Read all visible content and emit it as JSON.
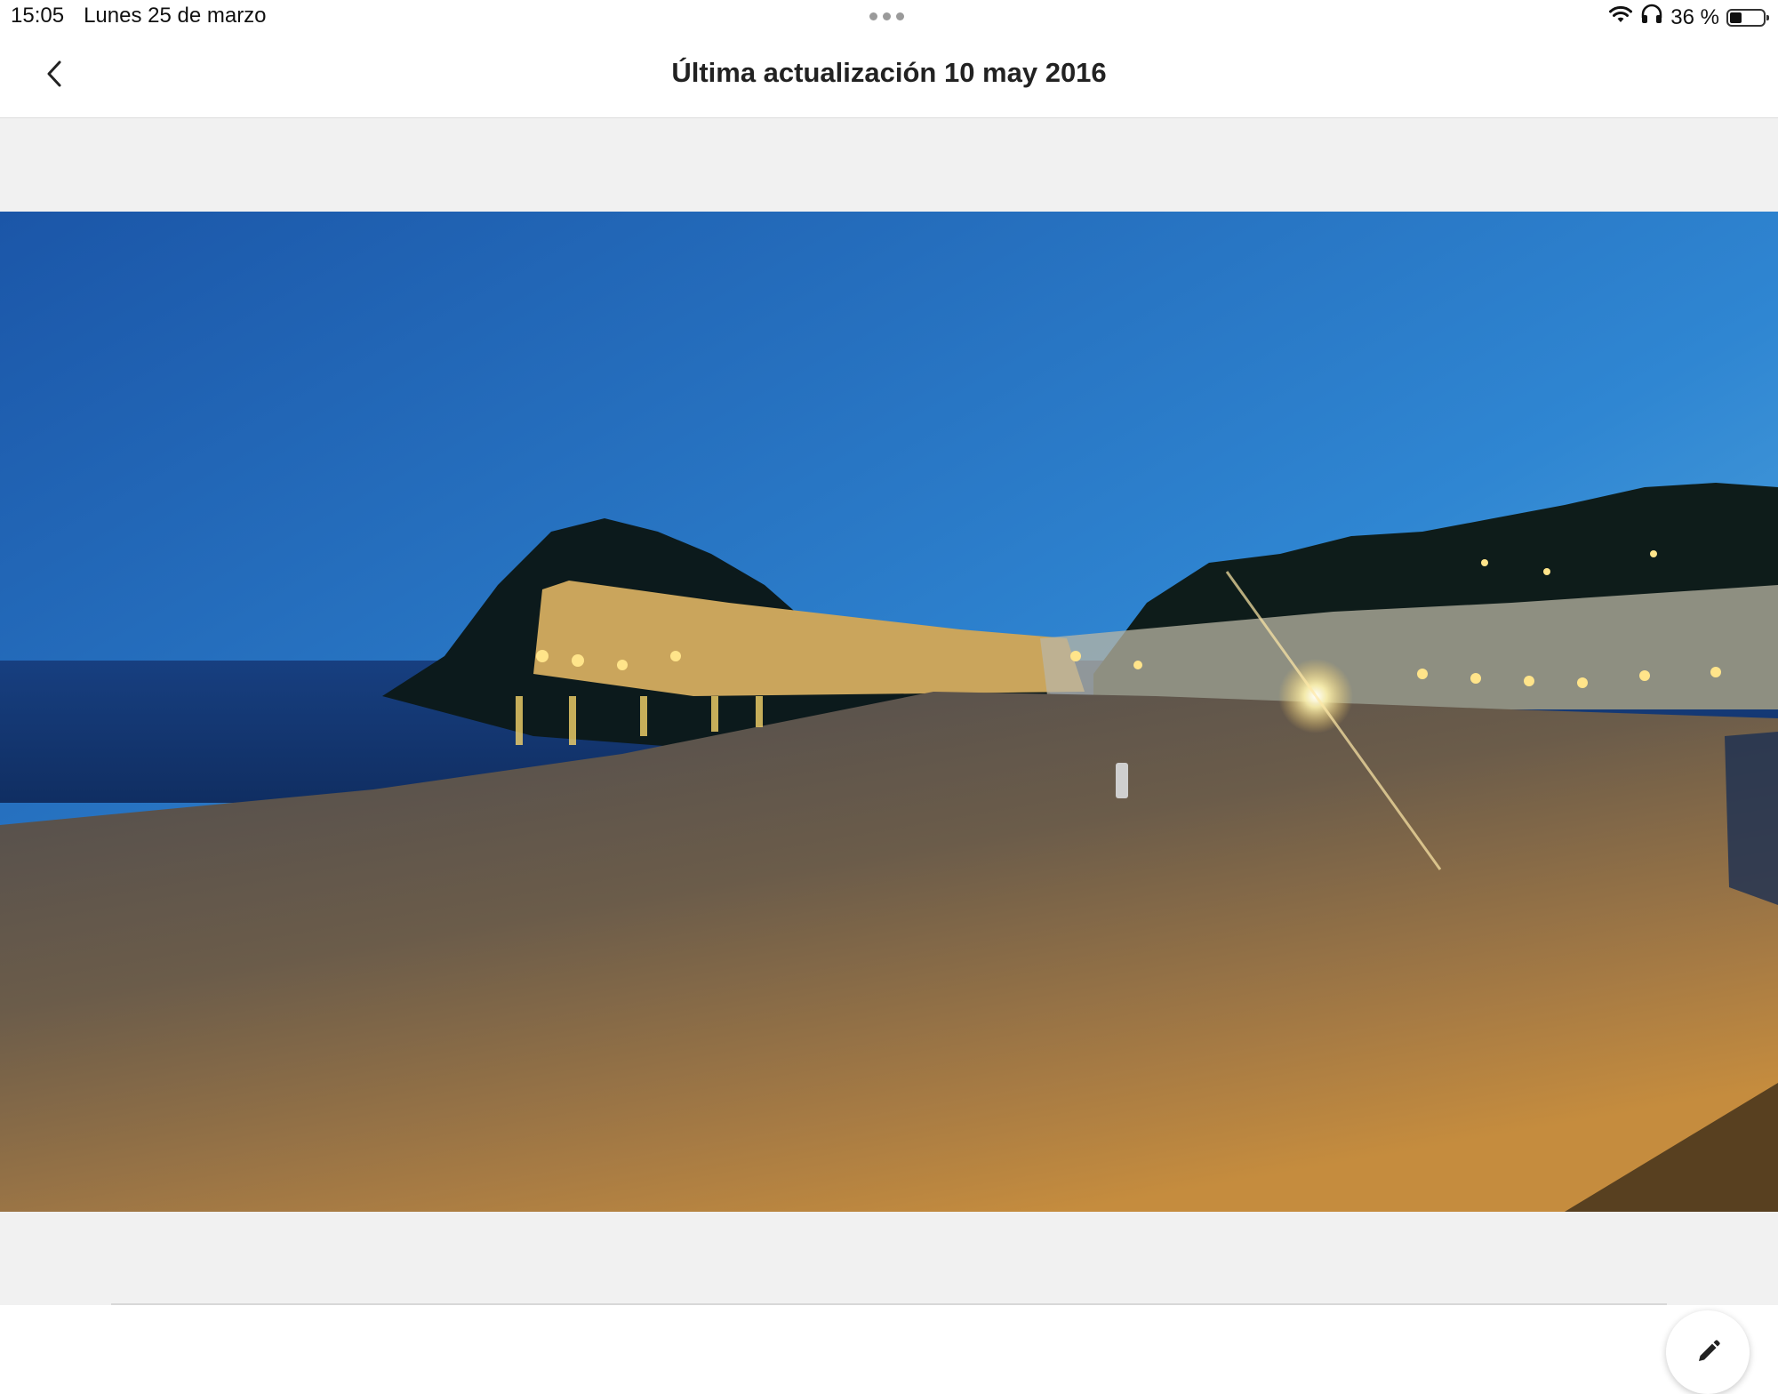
{
  "status_bar": {
    "time": "15:05",
    "date": "Lunes 25 de marzo",
    "battery_percent": "36 %",
    "battery_level": 0.36,
    "icons": [
      "wifi-icon",
      "headphones-icon",
      "battery-icon"
    ]
  },
  "header": {
    "title": "Última actualización 10 may 2016",
    "back_icon": "chevron-left-icon"
  },
  "photo": {
    "alt": "Playa de noche con castillo iluminado"
  },
  "actions": {
    "edit_icon": "pencil-icon"
  },
  "colors": {
    "background": "#f1f1f1",
    "header_bg": "#ffffff",
    "text": "#222222"
  }
}
